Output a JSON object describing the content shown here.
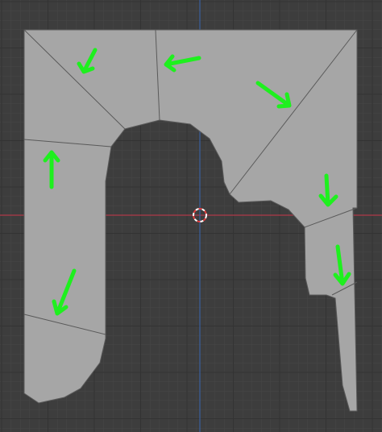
{
  "viewport": {
    "colors": {
      "background": "#3d3d3d",
      "grid_minor": "#464646",
      "grid_major": "#333333",
      "x_axis": "#b0384a",
      "y_axis": "#3a5f9e",
      "mesh_fill": "#a6a6a6",
      "mesh_edge": "#5a5a5a",
      "annotation": "#1ef01e",
      "cursor_red": "#e23c3c",
      "cursor_white": "#ffffff"
    },
    "mesh": {
      "face_count": 10
    },
    "annotations": [
      {
        "icon": "arrow-down-left"
      },
      {
        "icon": "arrow-left"
      },
      {
        "icon": "arrow-down-right"
      },
      {
        "icon": "arrow-up"
      },
      {
        "icon": "arrow-down"
      },
      {
        "icon": "arrow-down-left"
      },
      {
        "icon": "arrow-down"
      }
    ],
    "cursor_icon": "3d-cursor-icon"
  }
}
